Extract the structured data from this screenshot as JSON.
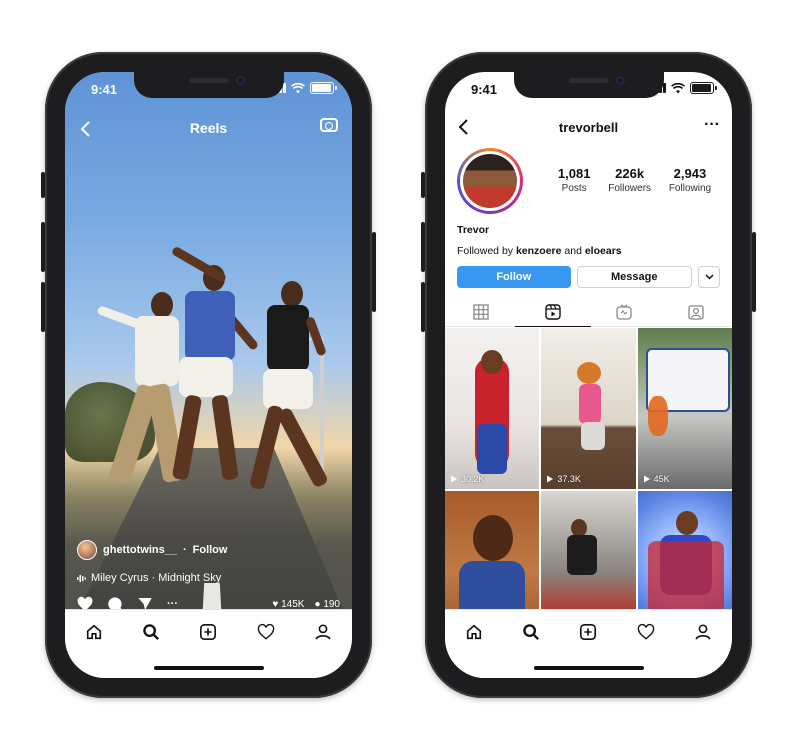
{
  "reels": {
    "status_time": "9:41",
    "title": "Reels",
    "username": "ghettotwins__",
    "separator": "·",
    "follow_label": "Follow",
    "music": "Miley Cyrus · Midnight Sky",
    "likes": "145K",
    "comments": "190",
    "more": "···",
    "icons": [
      "back-arrow-icon",
      "camera-icon",
      "heart-icon",
      "comment-icon",
      "send-icon",
      "more-icon"
    ]
  },
  "profile": {
    "status_time": "9:41",
    "username": "trevorbell",
    "more": "···",
    "stats": [
      {
        "num": "1,081",
        "label": "Posts"
      },
      {
        "num": "226k",
        "label": "Followers"
      },
      {
        "num": "2,943",
        "label": "Following"
      }
    ],
    "name": "Trevor",
    "followed_by_prefix": "Followed by ",
    "followed_user_1": "kenzoere",
    "followed_and": " and ",
    "followed_user_2": "eloears",
    "follow_button": "Follow",
    "message_button": "Message",
    "grid_views": [
      "30.2K",
      "37.3K",
      "45K"
    ]
  },
  "tabbar_icons": [
    "home-icon",
    "search-icon",
    "new-post-icon",
    "activity-icon",
    "profile-icon"
  ],
  "colors": {
    "follow_blue": "#3897f0",
    "phone_frame": "#1d1d1f"
  }
}
